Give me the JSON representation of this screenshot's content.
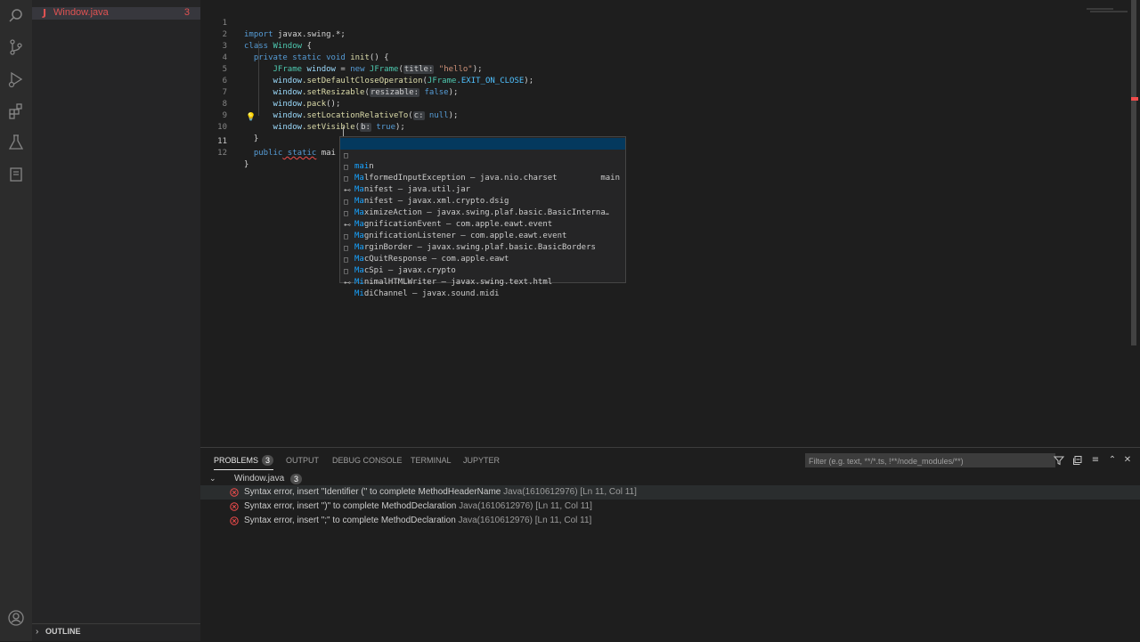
{
  "activity_bar": {
    "icons": [
      "search-icon",
      "source-control-icon",
      "run-debug-icon",
      "extensions-icon",
      "testing-icon",
      "jupyter-icon",
      "account-icon"
    ]
  },
  "explorer": {
    "file": {
      "icon": "J",
      "name": "Window.java",
      "badge": "3"
    },
    "outline_label": "OUTLINE"
  },
  "editor": {
    "lines": [
      {
        "num": "1"
      },
      {
        "num": "2"
      },
      {
        "num": "3"
      },
      {
        "num": "4"
      },
      {
        "num": "5"
      },
      {
        "num": "6"
      },
      {
        "num": "7"
      },
      {
        "num": "8"
      },
      {
        "num": "9"
      },
      {
        "num": "10"
      },
      {
        "num": "11"
      },
      {
        "num": "12"
      }
    ],
    "code": {
      "l1_kw": "import",
      "l1_rest": " javax.swing.*;",
      "l2_kw": "class",
      "l2_name": "Window",
      "l2_brace": " {",
      "l3_kw": "private static void",
      "l3_fn": "init",
      "l3_rest": "() {",
      "l4_type": "JFrame",
      "l4_var": " window",
      "l4_eq": " = ",
      "l4_new": "new",
      "l4_ctor": " JFrame",
      "l4_open": "(",
      "l4_hint": "title:",
      "l4_str": "\"hello\"",
      "l4_close": ");",
      "l5_var": "window",
      "l5_fn": ".setDefaultCloseOperation",
      "l5_open": "(",
      "l5_type": "JFrame",
      "l5_cst": ".EXIT_ON_CLOSE",
      "l5_close": ");",
      "l6_var": "window",
      "l6_fn": ".setResizable",
      "l6_open": "(",
      "l6_hint": "resizable:",
      "l6_kw": " false",
      "l6_close": ");",
      "l7_var": "window",
      "l7_fn": ".pack",
      "l7_close": "();",
      "l8_var": "window",
      "l8_fn": ".setLocationRelativeTo",
      "l8_open": "(",
      "l8_hint": "c:",
      "l8_kw": " null",
      "l8_close": ");",
      "l9_var": "window",
      "l9_fn": ".setVisible",
      "l9_open": "(",
      "l9_hint": "b:",
      "l9_kw": " true",
      "l9_close": ");",
      "l10": "}",
      "l11_kw1": "public",
      "l11_kw2": " static",
      "l11_typed": " mai",
      "l12": "}"
    }
  },
  "suggest": {
    "items": [
      {
        "icon": "□",
        "match": "mai",
        "rest": "n",
        "detail": "main"
      },
      {
        "icon": "□",
        "match": "Ma",
        "rest": "lformedInputException – java.nio.charset",
        "detail": ""
      },
      {
        "icon": "□",
        "match": "Ma",
        "rest": "nifest – java.util.jar",
        "detail": ""
      },
      {
        "icon": "⊷",
        "match": "Ma",
        "rest": "nifest – javax.xml.crypto.dsig",
        "detail": ""
      },
      {
        "icon": "□",
        "match": "Ma",
        "rest": "ximizeAction – javax.swing.plaf.basic.BasicInterna…",
        "detail": ""
      },
      {
        "icon": "□",
        "match": "Ma",
        "rest": "gnificationEvent – com.apple.eawt.event",
        "detail": ""
      },
      {
        "icon": "⊷",
        "match": "Ma",
        "rest": "gnificationListener – com.apple.eawt.event",
        "detail": ""
      },
      {
        "icon": "□",
        "match": "Ma",
        "rest": "rginBorder – javax.swing.plaf.basic.BasicBorders",
        "detail": ""
      },
      {
        "icon": "□",
        "match": "Ma",
        "rest": "cQuitResponse – com.apple.eawt",
        "detail": ""
      },
      {
        "icon": "□",
        "match": "Ma",
        "rest": "cSpi – javax.crypto",
        "detail": ""
      },
      {
        "icon": "□",
        "match": "Mi",
        "rest": "nimalHTMLWriter – javax.swing.text.html",
        "detail": ""
      },
      {
        "icon": "⊷",
        "match": "Mi",
        "rest": "diChannel – javax.sound.midi",
        "detail": ""
      }
    ]
  },
  "panel": {
    "tabs": [
      {
        "label": "PROBLEMS",
        "badge": "3"
      },
      {
        "label": "OUTPUT"
      },
      {
        "label": "DEBUG CONSOLE"
      },
      {
        "label": "TERMINAL"
      },
      {
        "label": "JUPYTER"
      }
    ],
    "filter_placeholder": "Filter (e.g. text, **/*.ts, !**/node_modules/**)",
    "problem_file": {
      "name": "Window.java",
      "count": "3"
    },
    "problems": [
      {
        "message": "Syntax error, insert \"Identifier (\" to complete MethodHeaderName",
        "source": "Java(1610612976)",
        "location": "[Ln 11, Col 11]"
      },
      {
        "message": "Syntax error, insert \")\" to complete MethodDeclaration",
        "source": "Java(1610612976)",
        "location": "[Ln 11, Col 11]"
      },
      {
        "message": "Syntax error, insert \";\" to complete MethodDeclaration",
        "source": "Java(1610612976)",
        "location": "[Ln 11, Col 11]"
      }
    ]
  },
  "colors": {
    "error": "#f14c4c",
    "accent": "#18a3ff",
    "selection": "#04395e"
  }
}
